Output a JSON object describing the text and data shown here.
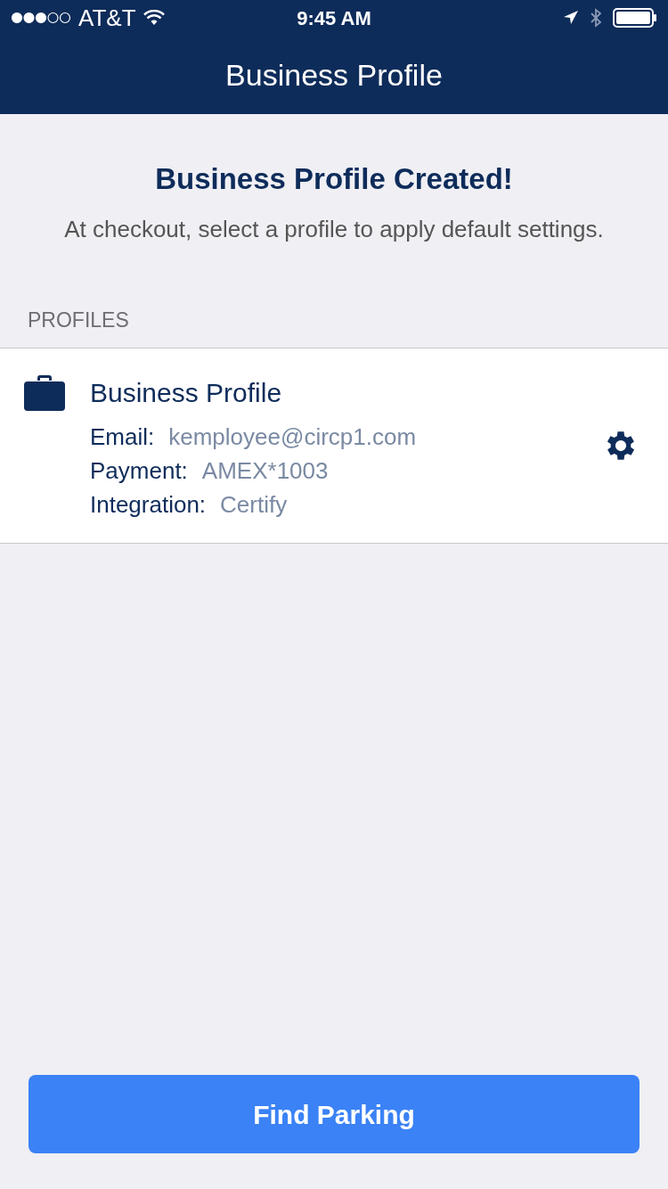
{
  "status_bar": {
    "carrier": "AT&T",
    "time": "9:45 AM"
  },
  "nav": {
    "title": "Business Profile"
  },
  "header": {
    "title": "Business Profile Created!",
    "subtitle": "At checkout, select a profile to apply default settings."
  },
  "section": {
    "label": "PROFILES"
  },
  "profiles": [
    {
      "name": "Business Profile",
      "details": [
        {
          "label": "Email:",
          "value": "kemployee@circp1.com"
        },
        {
          "label": "Payment:",
          "value": "AMEX*1003"
        },
        {
          "label": "Integration:",
          "value": "Certify"
        }
      ]
    }
  ],
  "button": {
    "label": "Find Parking"
  }
}
